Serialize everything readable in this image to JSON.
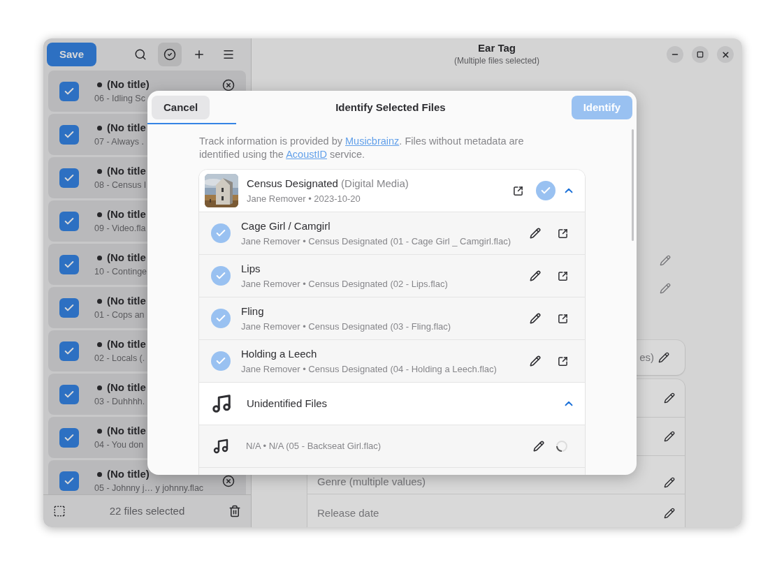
{
  "window": {
    "title": "Ear Tag",
    "subtitle": "(Multiple files selected)"
  },
  "sidebar": {
    "save_button": "Save",
    "toolbar": [
      {
        "kind": "search",
        "selected": false
      },
      {
        "kind": "select",
        "selected": true
      },
      {
        "kind": "add",
        "selected": false
      },
      {
        "kind": "menu",
        "selected": false
      }
    ],
    "files": [
      {
        "title": "(No title)",
        "subtitle": "06 - Idling Sc",
        "checked": true,
        "modified": true
      },
      {
        "title": "(No title",
        "subtitle": "07 - Always .",
        "checked": true,
        "modified": true
      },
      {
        "title": "(No title",
        "subtitle": "08 - Census I",
        "checked": true,
        "modified": true
      },
      {
        "title": "(No title",
        "subtitle": "09 - Video.fla",
        "checked": true,
        "modified": true
      },
      {
        "title": "(No title",
        "subtitle": "10 - Continge",
        "checked": true,
        "modified": true
      },
      {
        "title": "(No title",
        "subtitle": "01 - Cops an",
        "checked": true,
        "modified": true
      },
      {
        "title": "(No title",
        "subtitle": "02 - Locals (.",
        "checked": true,
        "modified": true
      },
      {
        "title": "(No title",
        "subtitle": "03 - Duhhhh.",
        "checked": true,
        "modified": true
      },
      {
        "title": "(No title",
        "subtitle": "04 - You don",
        "checked": true,
        "modified": true
      },
      {
        "title": "(No title)",
        "subtitle": "05 - Johnny j…  y johnny.flac",
        "checked": true,
        "modified": true
      }
    ],
    "footer": "22 files selected"
  },
  "details": [
    {
      "kind": "bare"
    },
    {
      "kind": "bare"
    },
    {
      "kind": "card",
      "text": "es)"
    },
    {
      "kind": "grouped"
    },
    {
      "kind": "grouped"
    },
    {
      "kind": "grouped",
      "text": "Genre (multiple values)"
    },
    {
      "kind": "grouped",
      "text": "Release date"
    }
  ],
  "dialog": {
    "cancel": "Cancel",
    "title": "Identify Selected Files",
    "identify": {
      "label": "Identify",
      "disabled": true
    },
    "intro": {
      "before": "Track information is provided by ",
      "link_1": "Musicbrainz",
      "middle": ". Files without metadata are identified using the ",
      "link_2": "AcoustID",
      "after": " service."
    },
    "groups": [
      {
        "kind": "album",
        "title": "Census Designated",
        "detail": "(Digital Media)",
        "subtitle": "Jane Remover • 2023-10-20",
        "selected": true,
        "expanded": true,
        "tracks": [
          {
            "title": "Cage Girl / Camgirl",
            "subtitle": "Jane Remover • Census Designated (01 - Cage Girl _ Camgirl.flac)",
            "selected": true
          },
          {
            "title": "Lips",
            "subtitle": "Jane Remover • Census Designated (02 - Lips.flac)",
            "selected": true
          },
          {
            "title": "Fling",
            "subtitle": "Jane Remover • Census Designated (03 - Fling.flac)",
            "selected": true
          },
          {
            "title": "Holding a Leech",
            "subtitle": "Jane Remover • Census Designated (04 - Holding a Leech.flac)",
            "selected": true
          }
        ]
      },
      {
        "kind": "unidentified",
        "title": "Unidentified Files",
        "expanded": true,
        "tracks": [
          {
            "subtitle": "N/A • N/A (05 - Backseat Girl.flac)",
            "loading": true
          }
        ]
      }
    ]
  }
}
